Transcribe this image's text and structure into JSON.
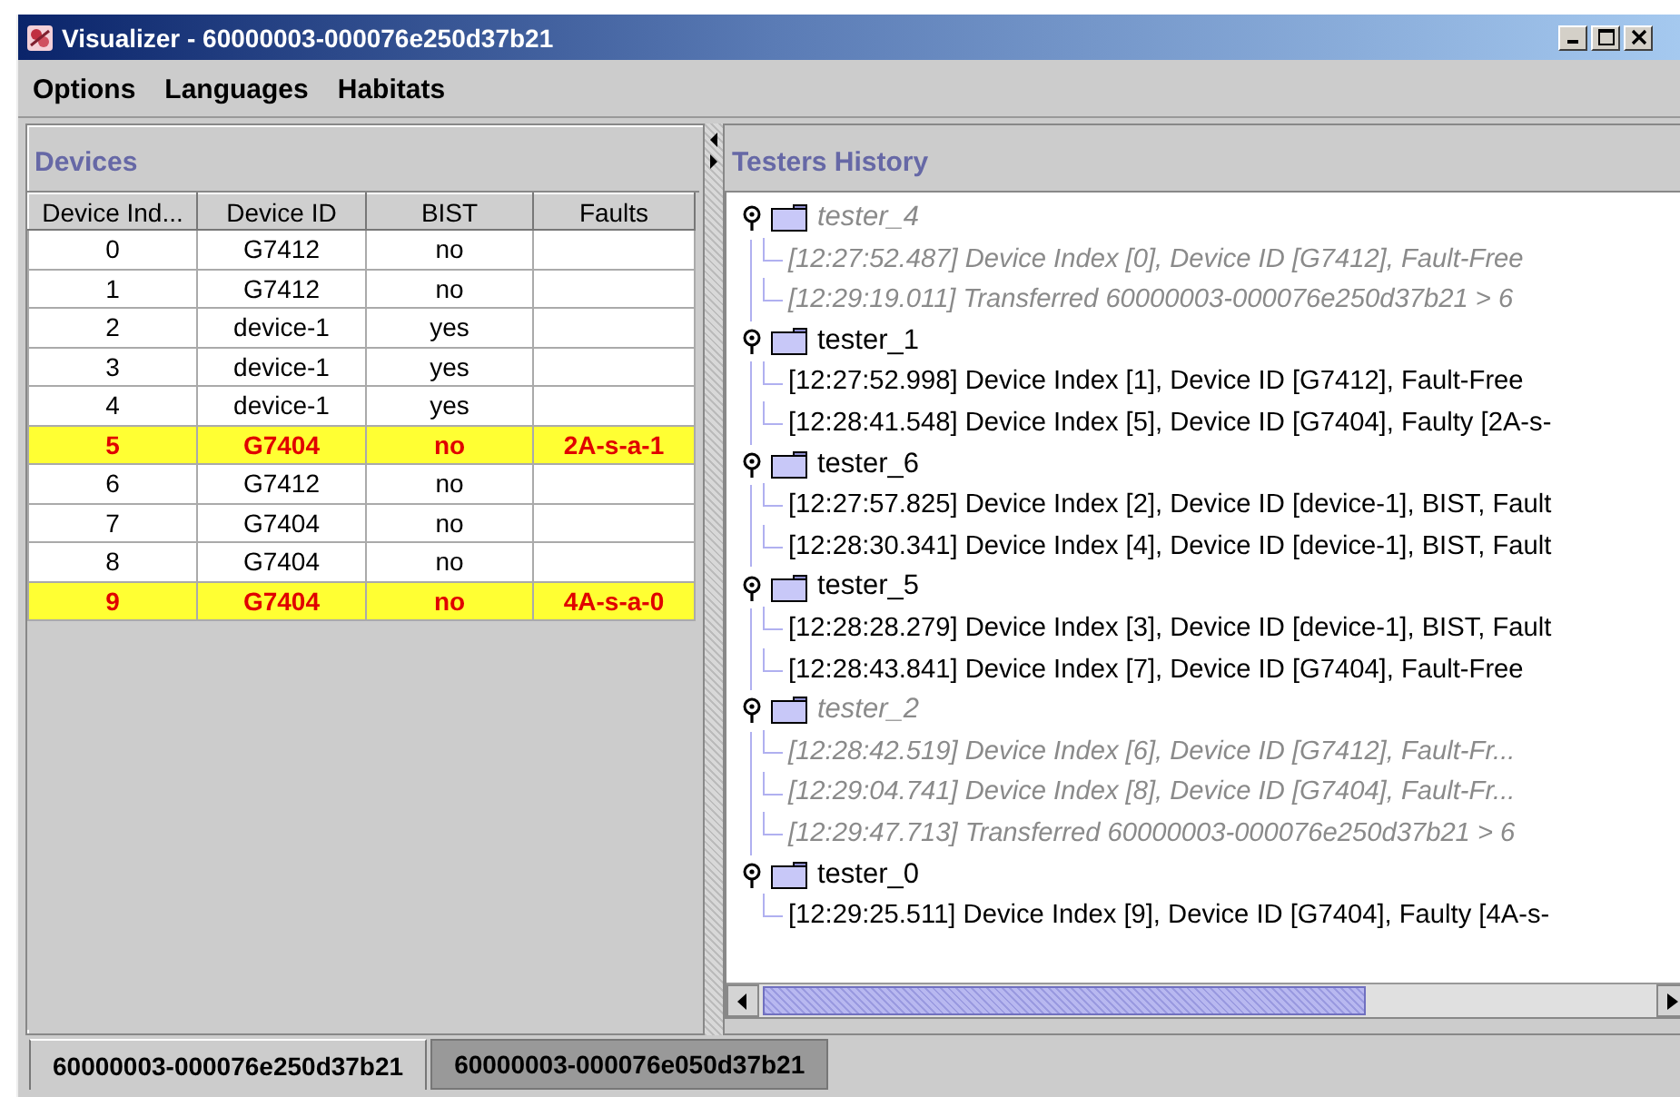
{
  "window": {
    "title": "Visualizer - 60000003-000076e250d37b21"
  },
  "menu": [
    "Options",
    "Languages",
    "Habitats"
  ],
  "devices": {
    "title": "Devices",
    "columns": [
      "Device Ind...",
      "Device ID",
      "BIST",
      "Faults"
    ],
    "rows": [
      {
        "cells": [
          "0",
          "G7412",
          "no",
          ""
        ],
        "faulty": false
      },
      {
        "cells": [
          "1",
          "G7412",
          "no",
          ""
        ],
        "faulty": false
      },
      {
        "cells": [
          "2",
          "device-1",
          "yes",
          ""
        ],
        "faulty": false
      },
      {
        "cells": [
          "3",
          "device-1",
          "yes",
          ""
        ],
        "faulty": false
      },
      {
        "cells": [
          "4",
          "device-1",
          "yes",
          ""
        ],
        "faulty": false
      },
      {
        "cells": [
          "5",
          "G7404",
          "no",
          "2A-s-a-1"
        ],
        "faulty": true
      },
      {
        "cells": [
          "6",
          "G7412",
          "no",
          ""
        ],
        "faulty": false
      },
      {
        "cells": [
          "7",
          "G7404",
          "no",
          ""
        ],
        "faulty": false
      },
      {
        "cells": [
          "8",
          "G7404",
          "no",
          ""
        ],
        "faulty": false
      },
      {
        "cells": [
          "9",
          "G7404",
          "no",
          "4A-s-a-0"
        ],
        "faulty": true
      }
    ]
  },
  "history": {
    "title": "Testers History",
    "testers": [
      {
        "name": "tester_4",
        "disabled": true,
        "children": [
          {
            "text": "[12:27:52.487] Device Index [0], Device ID [G7412], Fault-Free"
          },
          {
            "text": "[12:29:19.011] Transferred 60000003-000076e250d37b21 > 6"
          }
        ]
      },
      {
        "name": "tester_1",
        "disabled": false,
        "children": [
          {
            "text": "[12:27:52.998] Device Index [1], Device ID [G7412], Fault-Free"
          },
          {
            "text": "[12:28:41.548] Device Index [5], Device ID [G7404], Faulty [2A-s-"
          }
        ]
      },
      {
        "name": "tester_6",
        "disabled": false,
        "children": [
          {
            "text": "[12:27:57.825] Device Index [2], Device ID [device-1], BIST, Fault"
          },
          {
            "text": "[12:28:30.341] Device Index [4], Device ID [device-1], BIST, Fault"
          }
        ]
      },
      {
        "name": "tester_5",
        "disabled": false,
        "children": [
          {
            "text": "[12:28:28.279] Device Index [3], Device ID [device-1], BIST, Fault"
          },
          {
            "text": "[12:28:43.841] Device Index [7], Device ID [G7404], Fault-Free"
          }
        ]
      },
      {
        "name": "tester_2",
        "disabled": true,
        "children": [
          {
            "text": "[12:28:42.519] Device Index [6], Device ID [G7412], Fault-Fr..."
          },
          {
            "text": "[12:29:04.741] Device Index [8], Device ID [G7404], Fault-Fr..."
          },
          {
            "text": "[12:29:47.713] Transferred 60000003-000076e250d37b21 > 6"
          }
        ]
      },
      {
        "name": "tester_0",
        "disabled": false,
        "children": [
          {
            "text": "[12:29:25.511] Device Index [9], Device ID [G7404], Faulty [4A-s-"
          }
        ]
      }
    ]
  },
  "tabs": [
    {
      "label": "60000003-000076e250d37b21",
      "selected": true
    },
    {
      "label": "60000003-000076e050d37b21",
      "selected": false
    }
  ]
}
